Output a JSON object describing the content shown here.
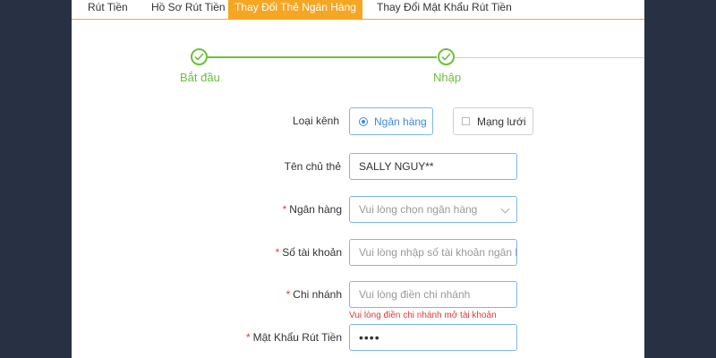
{
  "tabs": [
    {
      "label": "Rút Tiền",
      "active": false
    },
    {
      "label": "Hồ Sơ Rút Tiền",
      "active": false
    },
    {
      "label": "Thay Đổi Thẻ Ngân Hàng",
      "active": true
    },
    {
      "label": "Thay Đổi Mật Khẩu Rút Tiền",
      "active": false
    }
  ],
  "steps": [
    {
      "label": "Bắt đầu",
      "done": true
    },
    {
      "label": "Nhập",
      "done": true
    }
  ],
  "form": {
    "channel": {
      "label": "Loại kênh",
      "options": [
        {
          "label": "Ngân hàng",
          "selected": true
        },
        {
          "label": "Mạng lưới",
          "selected": false
        }
      ]
    },
    "holder": {
      "label": "Tên chủ thẻ",
      "required": false,
      "value": "SALLY NGUY**"
    },
    "bank": {
      "label": "Ngân hàng",
      "required": true,
      "placeholder": "Vui lòng chọn ngân hàng"
    },
    "account": {
      "label": "Số tài khoản",
      "required": true,
      "placeholder": "Vui lòng nhập số tài khoản ngân hà"
    },
    "branch": {
      "label": "Chi nhánh",
      "required": true,
      "placeholder": "Vui lòng điền chi nhánh",
      "error": "Vui lòng điền chi nhánh mở tài khoản"
    },
    "password": {
      "label": "Mật Khẩu Rút Tiền",
      "required": true,
      "value": "••••"
    },
    "required_mark": "*"
  },
  "colors": {
    "accent": "#f5a623",
    "success": "#6cbf3e",
    "field_border": "#7fb7e6",
    "error": "#e03b3b",
    "background": "#283044"
  }
}
